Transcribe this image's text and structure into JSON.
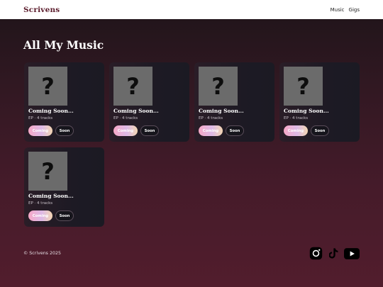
{
  "header": {
    "brand": "Scrivens",
    "nav": [
      "Music",
      "Gigs"
    ]
  },
  "main": {
    "title": "All My Music",
    "releases": [
      {
        "title": "Coming Soon...",
        "meta": "EP · 4 tracks",
        "placeholder": "?",
        "buttons": [
          "Coming",
          "Soon"
        ]
      },
      {
        "title": "Coming Soon...",
        "meta": "EP · 4 tracks",
        "placeholder": "?",
        "buttons": [
          "Coming",
          "Soon"
        ]
      },
      {
        "title": "Coming Soon...",
        "meta": "EP · 4 tracks",
        "placeholder": "?",
        "buttons": [
          "Coming",
          "Soon"
        ]
      },
      {
        "title": "Coming Soon...",
        "meta": "EP · 4 tracks",
        "placeholder": "?",
        "buttons": [
          "Coming",
          "Soon"
        ]
      },
      {
        "title": "Coming Soon...",
        "meta": "EP · 4 tracks",
        "placeholder": "?",
        "buttons": [
          "Coming",
          "Soon"
        ]
      }
    ]
  },
  "footer": {
    "copyright": "© Scrivens 2025",
    "social_icons": [
      "instagram-icon",
      "tiktok-icon",
      "youtube-icon"
    ]
  },
  "colors": {
    "brand": "#5a1b2b",
    "background_top": "#1e1419",
    "background_bottom": "#521d2d",
    "card": "#1d1a24",
    "cover_placeholder": "#6b6b6b"
  }
}
